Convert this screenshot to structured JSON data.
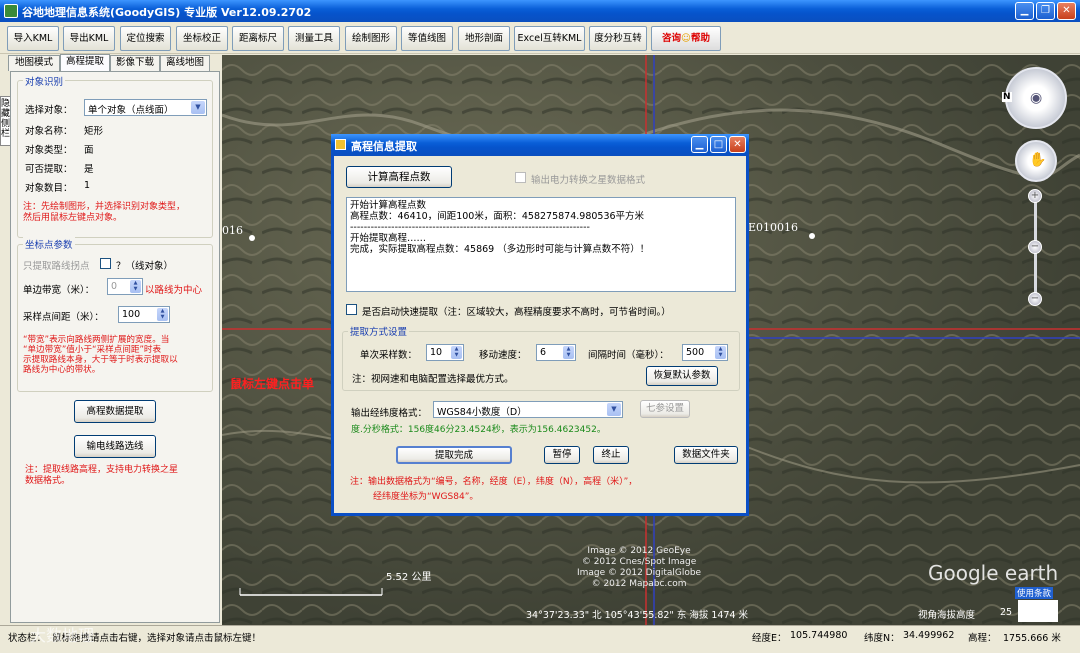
{
  "window": {
    "title": "谷地地理信息系统(GoodyGIS) 专业版  Ver12.09.2702",
    "min_icon": "minimize-icon",
    "max_icon": "maximize-icon",
    "close_icon": "close-icon"
  },
  "toolbar": {
    "buttons": [
      "导入KML",
      "导出KML",
      "定位搜索",
      "坐标校正",
      "距离标尺",
      "测量工具",
      "绘制图形",
      "等值线图",
      "地形剖面",
      "Excel互转KML",
      "度分秒互转"
    ],
    "help_prefix": "咨询",
    "help_label": "帮助"
  },
  "tabs": [
    "地图模式",
    "高程提取",
    "影像下载",
    "离线地图"
  ],
  "side_tab": "隐藏侧栏",
  "object_section": {
    "title": "对象识别",
    "select_label": "选择对象：",
    "select_value": "单个对象（点线面）",
    "name_label": "对象名称：",
    "name_value": "矩形",
    "type_label": "对象类型：",
    "type_value": "面",
    "extractable_label": "可否提取：",
    "extractable_value": "是",
    "count_label": "对象数目：",
    "count_value": "1",
    "note1": "注：先绘制图形，并选择识别对象类型，",
    "note2": "然后用鼠标左键点对象。"
  },
  "sample_section": {
    "title": "坐标点参数",
    "route_only_label": "只提取路线拐点",
    "route_only_suffix": "？（线对象）",
    "band_label": "单边带宽（米）：",
    "band_value": "0",
    "band_suffix": "以路线为中心",
    "interval_label": "采样点间距（米）：",
    "interval_value": "100",
    "note": [
      "“带宽”表示向路线两侧扩展的宽度。当",
      "“单边带宽”值小于“采样点间距”时表",
      "示提取路线本身，大于等于时表示提取以",
      "路线为中心的带状。"
    ]
  },
  "side_buttons": {
    "extract": "高程数据提取",
    "power_route": "输电线路选线"
  },
  "side_note": [
    "注：提取线路高程，支持电力转换之星",
    "数据格式。"
  ],
  "dialog": {
    "title": "高程信息提取",
    "calc_button": "计算高程点数",
    "power_format_label": "输出电力转换之星数据格式",
    "log": [
      "开始计算高程点数",
      "高程点数：46410，间距100米，面积：458275874.980536平方米",
      "----------------------------------------------------------------------",
      "开始提取高程……",
      "完成，实际提取高程点数：45869 （多边形时可能与计算点数不符）！"
    ],
    "fast_label": "是否启动快速提取（注：区域较大，高程精度要求不高时，可节省时间。）",
    "method_title": "提取方式设置",
    "batch_label": "单次采样数：",
    "batch_value": "10",
    "speed_label": "移动速度：",
    "speed_value": "6",
    "interval_label": "间隔时间（毫秒）：",
    "interval_value": "500",
    "config_note": "注：视网速和电脑配置选择最优方式。",
    "restore_button": "恢复默认参数",
    "format_label": "输出经纬度格式：",
    "format_value": "WGS84小数度（D）",
    "seven_param_button": "七参设置",
    "dms_note": "度.分秒格式：156度46分23.4524秒，表示为156.4623452。",
    "done_button": "提取完成",
    "pause_button": "暂停",
    "stop_button": "终止",
    "folder_button": "数据文件夹",
    "output_note1": "注：输出数据格式为“编号，名称，经度（E），纬度（N），高程（米）”，",
    "output_note2": "经纬度坐标为“WGS84”。"
  },
  "map": {
    "label_left": "016",
    "label_right": "E010016",
    "click_hint": "鼠标左键点击单",
    "scale": "5.52 公里",
    "copyright": [
      "Image © 2012 GeoEye",
      "© 2012 Cnes/Spot Image",
      "Image © 2012 DigitalGlobe",
      "© 2012 Mapabc.com"
    ],
    "coords": "34°37'23.33\" 北 105°43'55.82\" 东 海拔 1474 米",
    "eye_alt": "视角海拔高度",
    "eye_alt_val": "25",
    "brand": "Google earth",
    "terms": "使用条款",
    "north": "N"
  },
  "status": {
    "label": "状态栏：",
    "message": "鼠标拖拽请点击右键，选择对象请点击鼠标左键！",
    "lon_label": "经度E：",
    "lon_value": "105.744980",
    "lat_label": "纬度N：",
    "lat_value": "34.499962",
    "alt_label": "高程：",
    "alt_value": "1755.666 米"
  },
  "watermark": "大数地理"
}
